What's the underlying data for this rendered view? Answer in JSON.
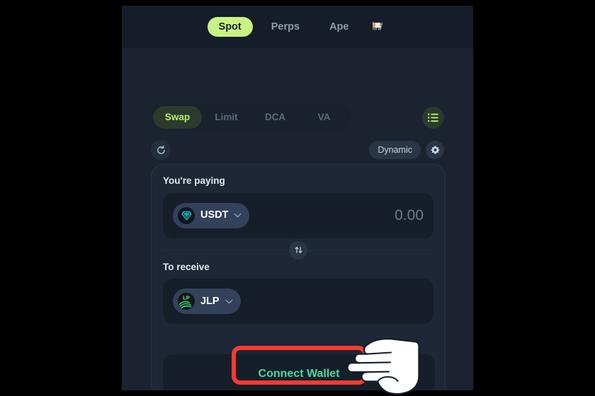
{
  "app": {
    "background_color": "#1b2330",
    "letterbox_color": "#000000"
  },
  "top_nav": {
    "items": [
      {
        "label": "Spot",
        "active": true,
        "name": "nav-tab-spot"
      },
      {
        "label": "Perps",
        "active": false,
        "name": "nav-tab-perps"
      },
      {
        "label": "Ape",
        "active": false,
        "name": "nav-tab-ape"
      }
    ],
    "dog_icon": "🐕",
    "active_pill_color": "#c9f284",
    "bar_color": "#151d28"
  },
  "order_tabs": {
    "items": [
      {
        "label": "Swap",
        "active": true
      },
      {
        "label": "Limit",
        "active": false
      },
      {
        "label": "DCA",
        "active": false
      },
      {
        "label": "VA",
        "active": false
      }
    ],
    "active_text_color": "#bdee6e",
    "active_bg_color": "#2c3a2d",
    "orders_icon": "list-icon"
  },
  "utility_row": {
    "refresh_icon": "refresh-icon",
    "dynamic_label": "Dynamic",
    "settings_icon": "gear-icon"
  },
  "swap_card": {
    "paying": {
      "label": "You're paying",
      "token_symbol": "USDT",
      "token_icon": "usdt-coin-icon",
      "amount": "0.00",
      "chevron": "chevron-down-icon"
    },
    "direction_toggle": {
      "icon": "swap-vertical-arrows-icon"
    },
    "receiving": {
      "label": "To receive",
      "token_symbol": "JLP",
      "token_icon": "jlp-coin-icon",
      "token_icon_text": "LP",
      "amount": "",
      "chevron": "chevron-down-icon"
    },
    "connect_wallet_label": "Connect Wallet",
    "connect_wallet_text_color": "#4bd6a0"
  },
  "annotation": {
    "highlight_color": "#fa3a33",
    "highlight_target": "connect-wallet-button",
    "cursor_type": "pointing-hand"
  }
}
